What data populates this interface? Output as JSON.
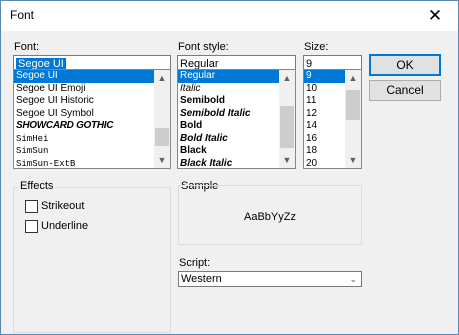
{
  "window": {
    "title": "Font",
    "close_glyph": "✕"
  },
  "font": {
    "label": "Font:",
    "value": "Segoe UI",
    "items": [
      "Segoe UI",
      "Segoe UI Emoji",
      "Segoe UI Historic",
      "Segoe UI Symbol",
      "SHOWCARD GOTHIC",
      "SimHei",
      "SimSun",
      "SimSun-ExtB"
    ],
    "selected_index": 0
  },
  "style": {
    "label": "Font style:",
    "value": "Regular",
    "items": [
      "Regular",
      "Italic",
      "Semibold",
      "Semibold Italic",
      "Bold",
      "Bold Italic",
      "Black",
      "Black Italic"
    ],
    "selected_index": 0
  },
  "size": {
    "label": "Size:",
    "value": "9",
    "items": [
      "9",
      "10",
      "11",
      "12",
      "14",
      "16",
      "18",
      "20"
    ],
    "selected_index": 0
  },
  "buttons": {
    "ok": "OK",
    "cancel": "Cancel"
  },
  "effects": {
    "label": "Effects",
    "strikeout": "Strikeout",
    "underline": "Underline",
    "strikeout_checked": false,
    "underline_checked": false
  },
  "sample": {
    "label": "Sample",
    "text": "AaBbYyZz"
  },
  "script": {
    "label": "Script:",
    "value": "Western"
  },
  "icons": {
    "up": "▲",
    "down": "▼",
    "combo_arrow": "⌄"
  }
}
